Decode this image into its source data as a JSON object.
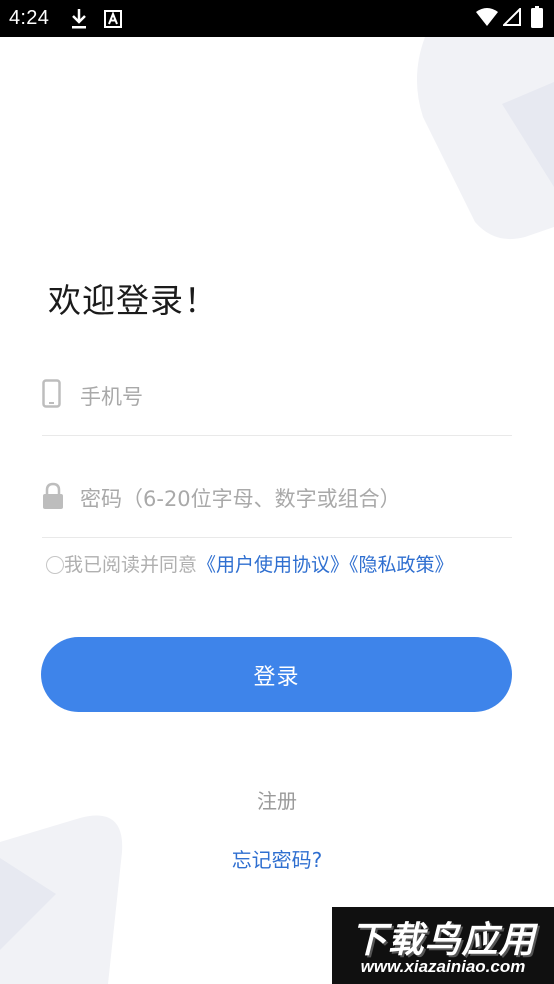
{
  "status_bar": {
    "time": "4:24",
    "icons": [
      "download-icon",
      "a-badge-icon",
      "wifi-icon",
      "signal-icon",
      "battery-icon"
    ]
  },
  "login": {
    "title": "欢迎登录！",
    "phone_placeholder": "手机号",
    "password_placeholder": "密码（6-20位字母、数字或组合）",
    "agree_prefix": "我已阅读并同意",
    "user_agreement": "《用户使用协议》",
    "privacy_policy": "《隐私政策》",
    "login_button": "登录",
    "register": "注册",
    "forgot_password": "忘记密码?"
  },
  "watermark": {
    "big": "下载鸟应用",
    "small": "www.xiazainiao.com"
  },
  "colors": {
    "accent": "#3e84ea",
    "link": "#2f6fd0",
    "placeholder": "#a9a9a9"
  }
}
